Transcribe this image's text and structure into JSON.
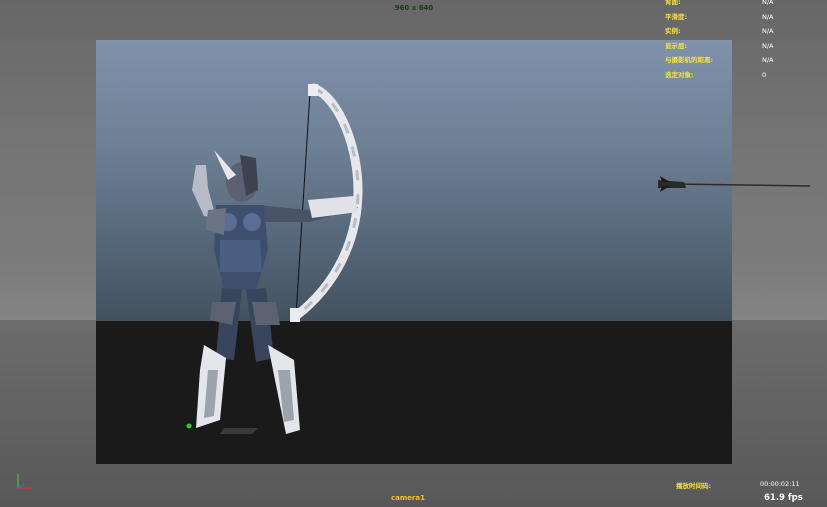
{
  "viewport": {
    "resolution_label": "960 x 640",
    "camera_label": "camera1"
  },
  "hud": {
    "rows": [
      {
        "label": "背面:",
        "value": "N/A"
      },
      {
        "label": "平滑度:",
        "value": "N/A"
      },
      {
        "label": "实例:",
        "value": "N/A"
      },
      {
        "label": "显示层:",
        "value": "N/A"
      },
      {
        "label": "与摄影机的距离:",
        "value": "N/A"
      },
      {
        "label": "选定对象:",
        "value": "0"
      }
    ]
  },
  "performance": {
    "label": "播放时间码:",
    "timecode": "00:00:02:11",
    "fps": "61.9 fps"
  },
  "colors": {
    "hud_label": "#f2e23a",
    "hud_value": "#ffffff",
    "camera_label": "#f2c51a",
    "gate_sky_top": "#7f92aa",
    "gate_floor": "#1a1a1a"
  },
  "icons": {
    "axis": "axis-gizmo-icon"
  }
}
